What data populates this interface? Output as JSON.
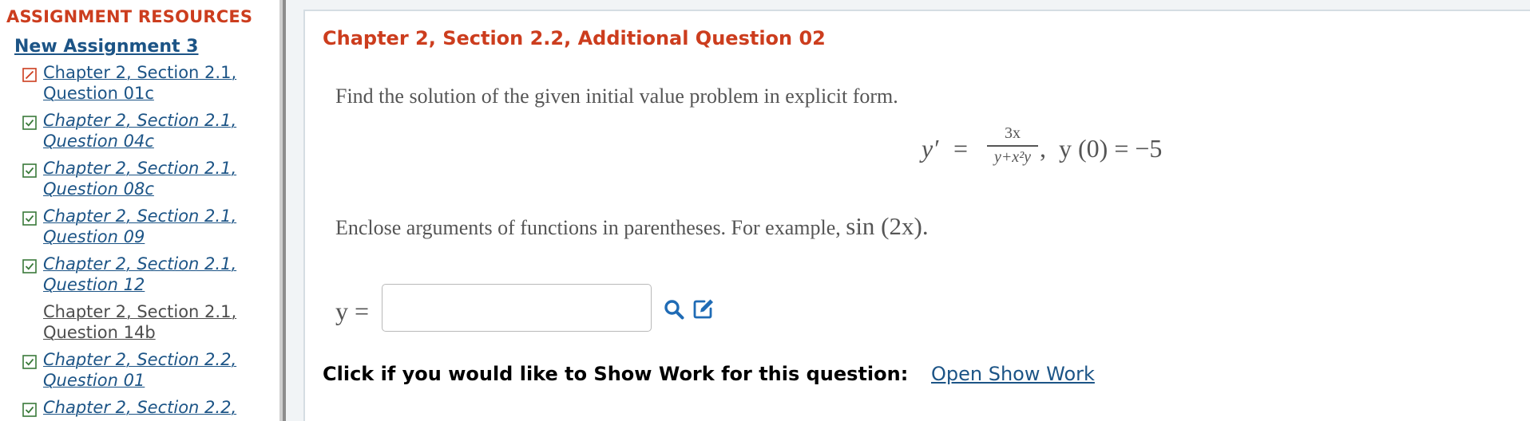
{
  "sidebar": {
    "heading": "ASSIGNMENT RESOURCES",
    "assignment": "New Assignment 3",
    "items": [
      {
        "line1": "Chapter 2, Section 2.1,",
        "line2": "Question 01c",
        "status": "current",
        "style": "normal"
      },
      {
        "line1": "Chapter 2, Section 2.1,",
        "line2": "Question 04c",
        "status": "done",
        "style": "italic"
      },
      {
        "line1": "Chapter 2, Section 2.1,",
        "line2": "Question 08c",
        "status": "done",
        "style": "italic"
      },
      {
        "line1": "Chapter 2, Section 2.1,",
        "line2": "Question 09",
        "status": "done",
        "style": "italic"
      },
      {
        "line1": "Chapter 2, Section 2.1,",
        "line2": "Question 12",
        "status": "done",
        "style": "italic"
      },
      {
        "line1": "Chapter 2, Section 2.1,",
        "line2": "Question 14b",
        "status": "none",
        "style": "normal"
      },
      {
        "line1": "Chapter 2, Section 2.2,",
        "line2": "Question 01",
        "status": "done",
        "style": "italic"
      },
      {
        "line1": "Chapter 2, Section 2.2,",
        "line2": "",
        "status": "done",
        "style": "italic"
      }
    ]
  },
  "question": {
    "title": "Chapter 2, Section 2.2, Additional Question 02",
    "prompt": "Find the solution of the given initial value problem in explicit form.",
    "equation": {
      "lhs": "y′",
      "equals": "=",
      "numerator": "3x",
      "denominator": "y+x²y",
      "comma": ",",
      "initial_condition": "y (0) = −5"
    },
    "instruction": "Enclose arguments of functions in parentheses. For example, ",
    "instruction_example": "sin (2x).",
    "answer_label": "y =",
    "answer_value": "",
    "show_work_prompt": "Click if you would like to Show Work for this question:",
    "show_work_link": "Open Show Work"
  },
  "colors": {
    "title_red": "#cc3d1e",
    "link_blue": "#1c5486",
    "icon_blue": "#1f6bb5",
    "check_green": "#3a7a3a",
    "check_red": "#cc3d1e"
  },
  "icons": {
    "current": "pencil-check-icon",
    "done": "checkmark-icon",
    "preview": "magnifier-icon",
    "editor": "edit-icon"
  }
}
